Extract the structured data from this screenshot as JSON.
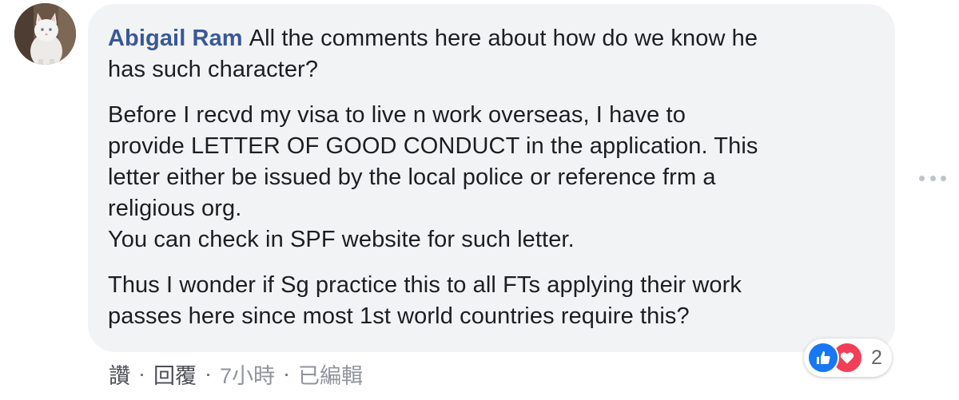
{
  "comment": {
    "author": "Abigail Ram",
    "paragraphs": [
      [
        "All the comments here about how do we know he",
        "has such character?"
      ],
      [
        "Before I recvd my visa to live n work overseas, I have to",
        "provide LETTER OF GOOD CONDUCT in the application. This",
        "letter either be issued by the local police or reference frm a",
        "religious org.",
        "You can check in SPF website for such letter."
      ],
      [
        "Thus I wonder if Sg practice this to all FTs applying their work",
        "passes here since most 1st world countries require this?"
      ]
    ],
    "reaction_count": "2",
    "reaction_icons": [
      "like-icon",
      "love-icon"
    ]
  },
  "actions": {
    "like_label": "讚",
    "separator": "·",
    "reply_label": "回覆",
    "time": "7小時",
    "edited_label": "已編輯"
  },
  "colors": {
    "author": "#385898",
    "bubble": "#f2f3f5",
    "like": "#1877f2",
    "love": "#f33e58"
  }
}
